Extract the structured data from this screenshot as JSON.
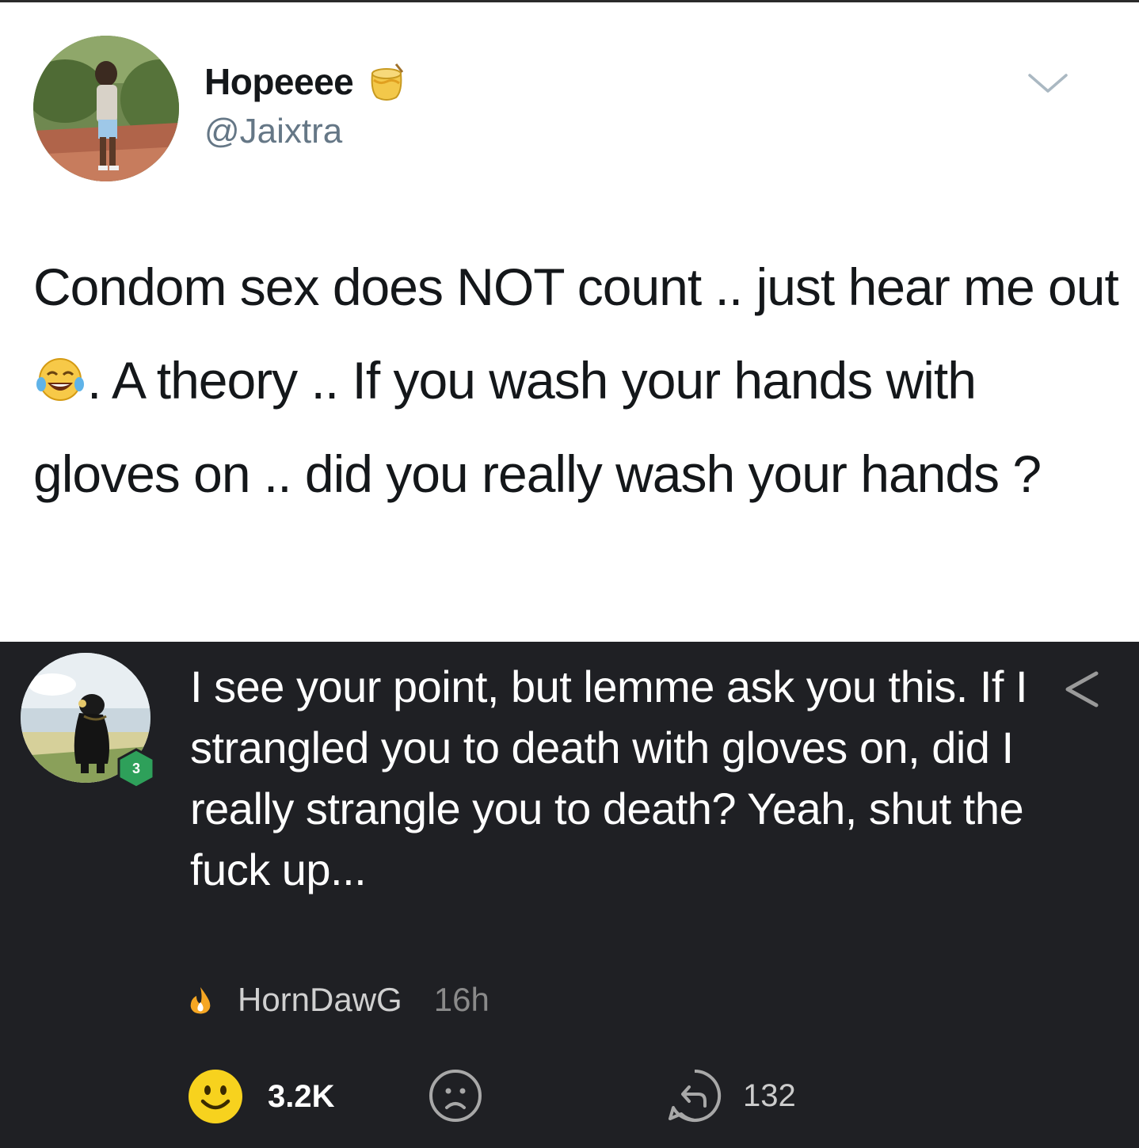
{
  "tweet": {
    "display_name": "Hopeeee",
    "handle": "@Jaixtra",
    "text_part1": "Condom sex does NOT count .. just hear me out ",
    "text_part2": ". A theory .. If you wash your hands with gloves on .. did you really wash your hands ?",
    "emoji": "face-with-tears-of-joy",
    "name_badge_icon": "honey-pot-icon"
  },
  "comment": {
    "text": "I see your point, but lemme ask you this. If I strangled you to death with gloves on, did I really strangle you to death? Yeah, shut the fuck up...",
    "author": "HornDawG",
    "time": "16h",
    "level": "3",
    "likes": "3.2K",
    "replies": "132"
  },
  "colors": {
    "tweet_bg": "#ffffff",
    "tweet_text": "#14171a",
    "tweet_handle": "#657786",
    "comment_bg": "#1f2024",
    "comment_text": "#ffffff",
    "like_yellow": "#f7d21e",
    "fire_orange": "#f5a623",
    "level_green": "#2ea05a"
  }
}
